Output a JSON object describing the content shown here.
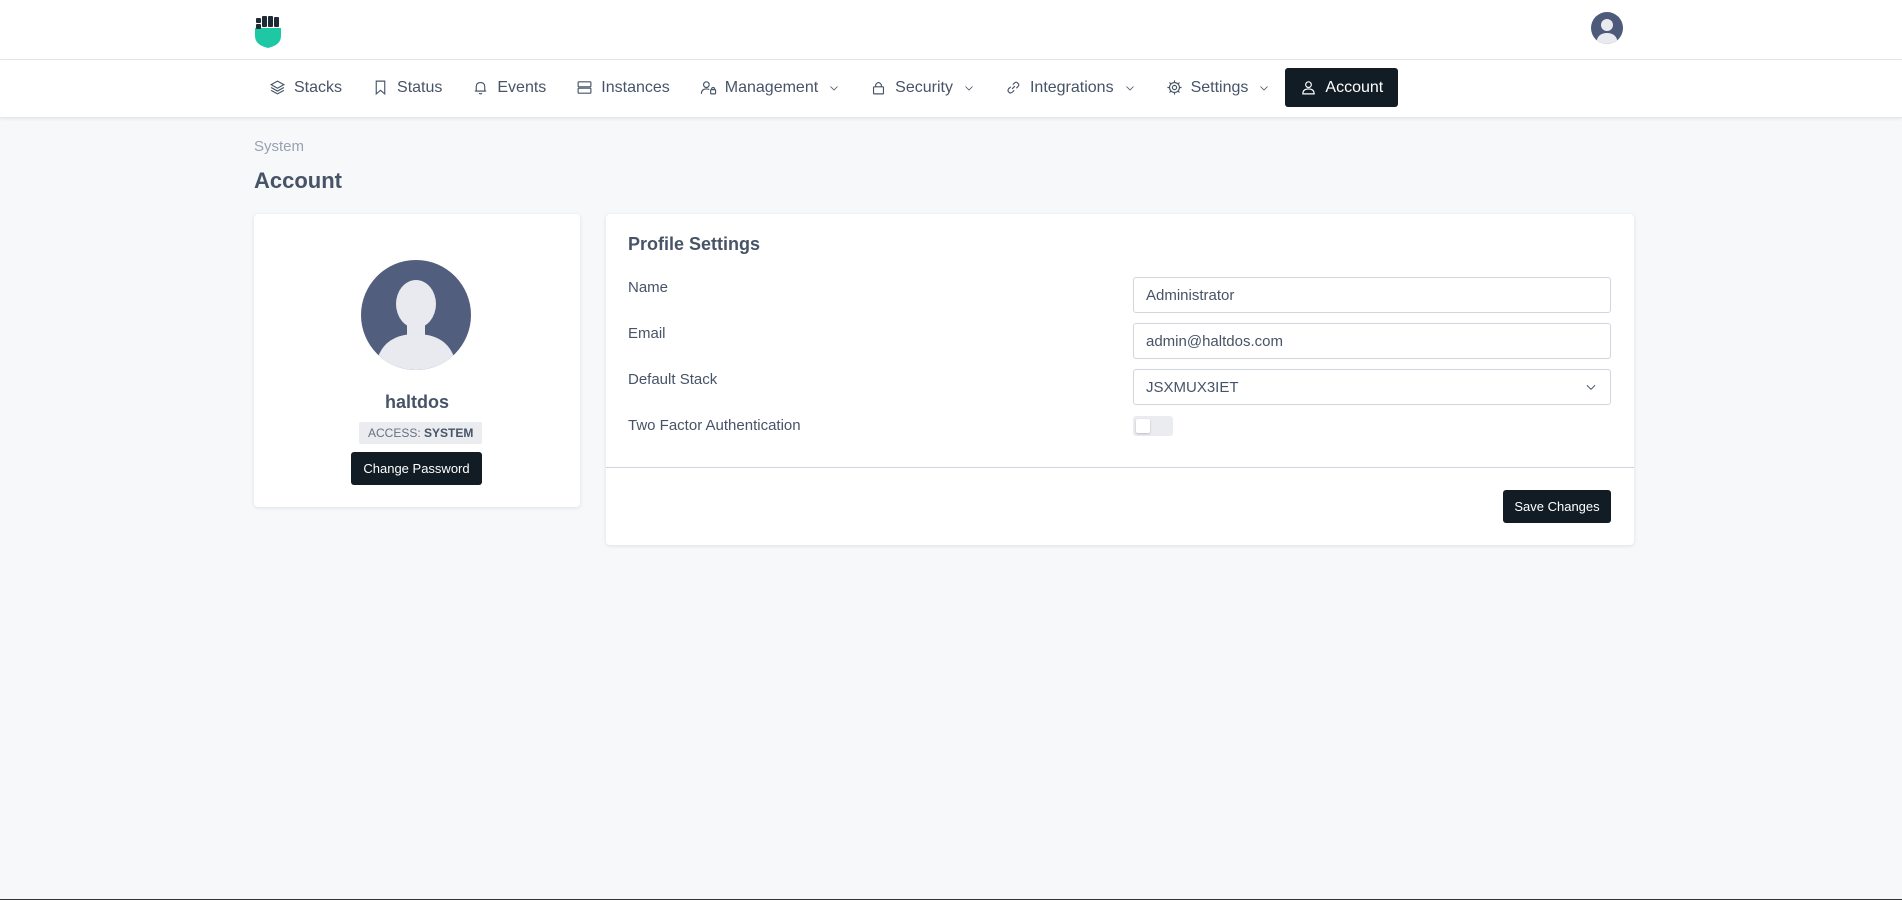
{
  "header": {
    "logo_icon": "fist-shield-logo",
    "avatar_icon": "user-avatar-icon",
    "accent": "#1ec8a5"
  },
  "nav": {
    "items": [
      {
        "label": "Stacks",
        "icon": "layers-icon",
        "has_dropdown": false
      },
      {
        "label": "Status",
        "icon": "bookmark-icon",
        "has_dropdown": false
      },
      {
        "label": "Events",
        "icon": "bell-icon",
        "has_dropdown": false
      },
      {
        "label": "Instances",
        "icon": "server-icon",
        "has_dropdown": false
      },
      {
        "label": "Management",
        "icon": "user-lock-icon",
        "has_dropdown": true
      },
      {
        "label": "Security",
        "icon": "lock-icon",
        "has_dropdown": true
      },
      {
        "label": "Integrations",
        "icon": "link-icon",
        "has_dropdown": true
      },
      {
        "label": "Settings",
        "icon": "gear-icon",
        "has_dropdown": true
      },
      {
        "label": "Account",
        "icon": "user-icon",
        "has_dropdown": false,
        "active": true
      }
    ]
  },
  "breadcrumb": "System",
  "page_title": "Account",
  "profile": {
    "username": "haltdos",
    "access_label": "ACCESS:",
    "access_value": "SYSTEM",
    "change_password_label": "Change Password"
  },
  "settings": {
    "title": "Profile Settings",
    "name_label": "Name",
    "name_value": "Administrator",
    "email_label": "Email",
    "email_value": "admin@haltdos.com",
    "stack_label": "Default Stack",
    "stack_value": "JSXMUX3IET",
    "two_factor_label": "Two Factor Authentication",
    "two_factor_enabled": false,
    "save_label": "Save Changes"
  }
}
